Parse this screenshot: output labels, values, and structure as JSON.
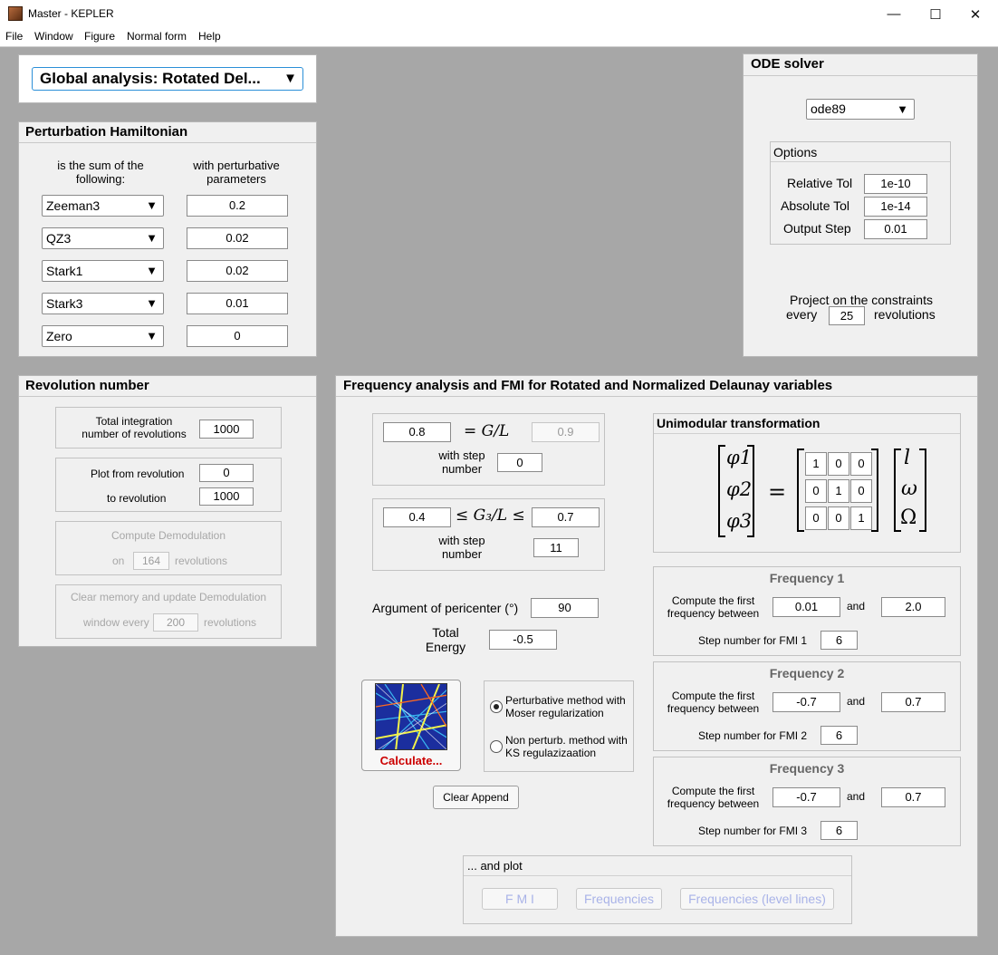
{
  "window": {
    "title": "Master - KEPLER",
    "minimize": "—",
    "maximize": "☐",
    "close": "✕"
  },
  "menu": [
    "File",
    "Window",
    "Figure",
    "Normal form",
    "Help"
  ],
  "analysis_select": {
    "value": "Global analysis: Rotated Del..."
  },
  "perturbation": {
    "title": "Perturbation Hamiltonian",
    "col1_header": "is the sum of the following:",
    "col2_header": "with perturbative parameters",
    "rows": [
      {
        "term": "Zeeman3",
        "param": "0.2"
      },
      {
        "term": "QZ3",
        "param": "0.02"
      },
      {
        "term": "Stark1",
        "param": "0.02"
      },
      {
        "term": "Stark3",
        "param": "0.01"
      },
      {
        "term": "Zero",
        "param": "0"
      }
    ]
  },
  "ode": {
    "title": "ODE solver",
    "solver": "ode89",
    "options_title": "Options",
    "rel_tol_label": "Relative Tol",
    "rel_tol": "1e-10",
    "abs_tol_label": "Absolute Tol",
    "abs_tol": "1e-14",
    "output_step_label": "Output Step",
    "output_step": "0.01",
    "project_label": "Project on the constraints",
    "every_label": "every",
    "every_value": "25",
    "revolutions_label": "revolutions"
  },
  "revolution": {
    "title": "Revolution number",
    "total_label": "Total integration number of revolutions",
    "total": "1000",
    "plot_from_label": "Plot from revolution",
    "plot_from": "0",
    "to_label": "to revolution",
    "to": "1000",
    "demod_title": "Compute Demodulation",
    "demod_on": "on",
    "demod_value": "164",
    "demod_rev": "revolutions",
    "clear_title": "Clear memory and update Demodulation",
    "clear_window": "window every",
    "clear_value": "200",
    "clear_rev": "revolutions"
  },
  "freq": {
    "title": "Frequency analysis and FMI for Rotated and Normalized  Delaunay variables",
    "gl_value": "0.8",
    "gl_eq": "= G/L",
    "gl_disabled": "0.9",
    "with_step_number": "with step number",
    "gl_step": "0",
    "g3_min": "0.4",
    "g3_mid": "≤ G₃/L ≤",
    "g3_max": "0.7",
    "g3_step": "11",
    "arg_label": "Argument of pericenter (°)",
    "arg_value": "90",
    "energy_label": "Total Energy",
    "energy_value": "-0.5",
    "calculate": "Calculate...",
    "method1": "Perturbative method with Moser regularization",
    "method2": "Non perturb. method with KS regulazizaation",
    "clear_append": "Clear Append",
    "unimodular_title": "Unimodular transformation",
    "phi": [
      "φ1",
      "φ2",
      "φ3"
    ],
    "vars": [
      "l",
      "ω",
      "Ω"
    ],
    "matrix": [
      [
        "1",
        "0",
        "0"
      ],
      [
        "0",
        "1",
        "0"
      ],
      [
        "0",
        "0",
        "1"
      ]
    ],
    "frequencies": [
      {
        "title": "Frequency 1",
        "label": "Compute the first frequency between",
        "from": "0.01",
        "and": "and",
        "to": "2.0",
        "step_label": "Step number for FMI 1",
        "step": "6"
      },
      {
        "title": "Frequency 2",
        "label": "Compute the first frequency between",
        "from": "-0.7",
        "and": "and",
        "to": "0.7",
        "step_label": "Step number for FMI 2",
        "step": "6"
      },
      {
        "title": "Frequency 3",
        "label": "Compute the first frequency between",
        "from": "-0.7",
        "and": "and",
        "to": "0.7",
        "step_label": "Step number for FMI 3",
        "step": "6"
      }
    ],
    "plot_title": "... and plot",
    "plot_buttons": [
      "F M I",
      "Frequencies",
      "Frequencies (level lines)"
    ]
  },
  "colors": {
    "calculate_red": "#cc0000",
    "disabled_blue": "#a9b3e8"
  }
}
